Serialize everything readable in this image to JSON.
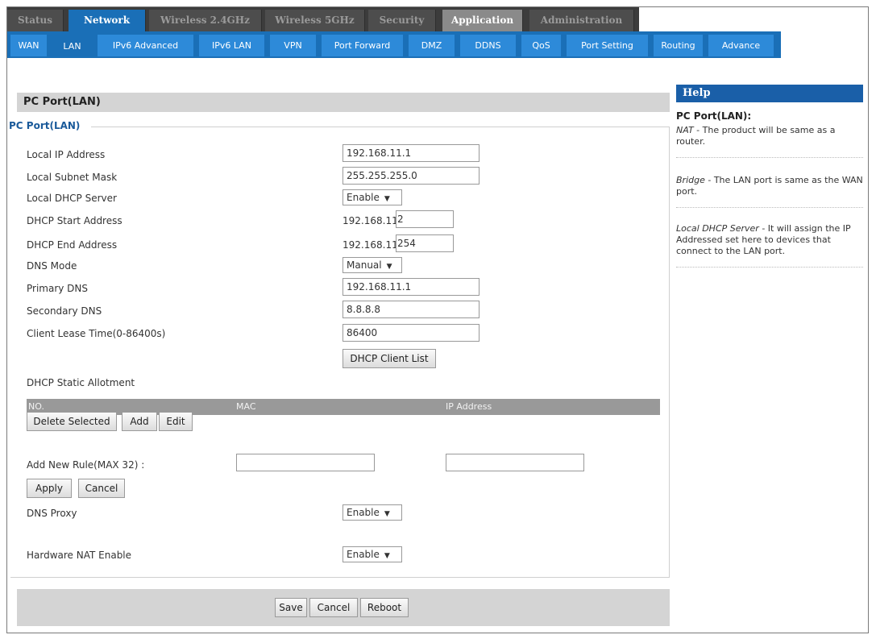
{
  "top_tabs": [
    "Status",
    "Network",
    "Wireless 2.4GHz",
    "Wireless 5GHz",
    "Security",
    "Application",
    "Administration"
  ],
  "sub_tabs": [
    "WAN",
    "LAN",
    "IPv6 Advanced",
    "IPv6 LAN",
    "VPN",
    "Port Forward",
    "DMZ",
    "DDNS",
    "QoS",
    "Port Setting",
    "Routing",
    "Advance"
  ],
  "section_title": "PC Port(LAN)",
  "fieldset_legend": "PC Port(LAN)",
  "form": {
    "local_ip_label": "Local IP Address",
    "local_ip_value": "192.168.11.1",
    "subnet_label": "Local Subnet Mask",
    "subnet_value": "255.255.255.0",
    "dhcp_server_label": "Local DHCP Server",
    "dhcp_server_value": "Enable",
    "dhcp_start_label": "DHCP Start Address",
    "dhcp_start_prefix": "192.168.11.",
    "dhcp_start_value": "2",
    "dhcp_end_label": "DHCP End Address",
    "dhcp_end_prefix": "192.168.11.",
    "dhcp_end_value": "254",
    "dns_mode_label": "DNS Mode",
    "dns_mode_value": "Manual",
    "primary_dns_label": "Primary DNS",
    "primary_dns_value": "192.168.11.1",
    "secondary_dns_label": "Secondary DNS",
    "secondary_dns_value": "8.8.8.8",
    "lease_label": "Client Lease Time(0-86400s)",
    "lease_value": "86400",
    "client_list_button": "DHCP Client List",
    "static_label": "DHCP Static Allotment",
    "table_headers": [
      "NO.",
      "MAC",
      "IP Address"
    ],
    "delete_button": "Delete Selected",
    "add_button": "Add",
    "edit_button": "Edit",
    "new_rule_label": "Add New Rule(MAX 32) :",
    "apply_button": "Apply",
    "cancel_button": "Cancel",
    "dns_proxy_label": "DNS Proxy",
    "dns_proxy_value": "Enable",
    "hw_nat_label": "Hardware NAT Enable",
    "hw_nat_value": "Enable"
  },
  "footer": {
    "save": "Save",
    "cancel": "Cancel",
    "reboot": "Reboot"
  },
  "help": {
    "header": "Help",
    "title": "PC Port(LAN):",
    "items": [
      {
        "term": "NAT",
        "text": " - The product will be same as a router."
      },
      {
        "term": "Bridge",
        "text": " - The LAN port is same as the WAN port."
      },
      {
        "term": "Local DHCP Server",
        "text": " - It will assign the IP Addressed set here to devices that connect to the LAN port."
      }
    ]
  },
  "dropdown_arrow": "▼",
  "colors": {
    "accent_blue": "#1a6fb7",
    "help_header": "#1a5fa8"
  }
}
